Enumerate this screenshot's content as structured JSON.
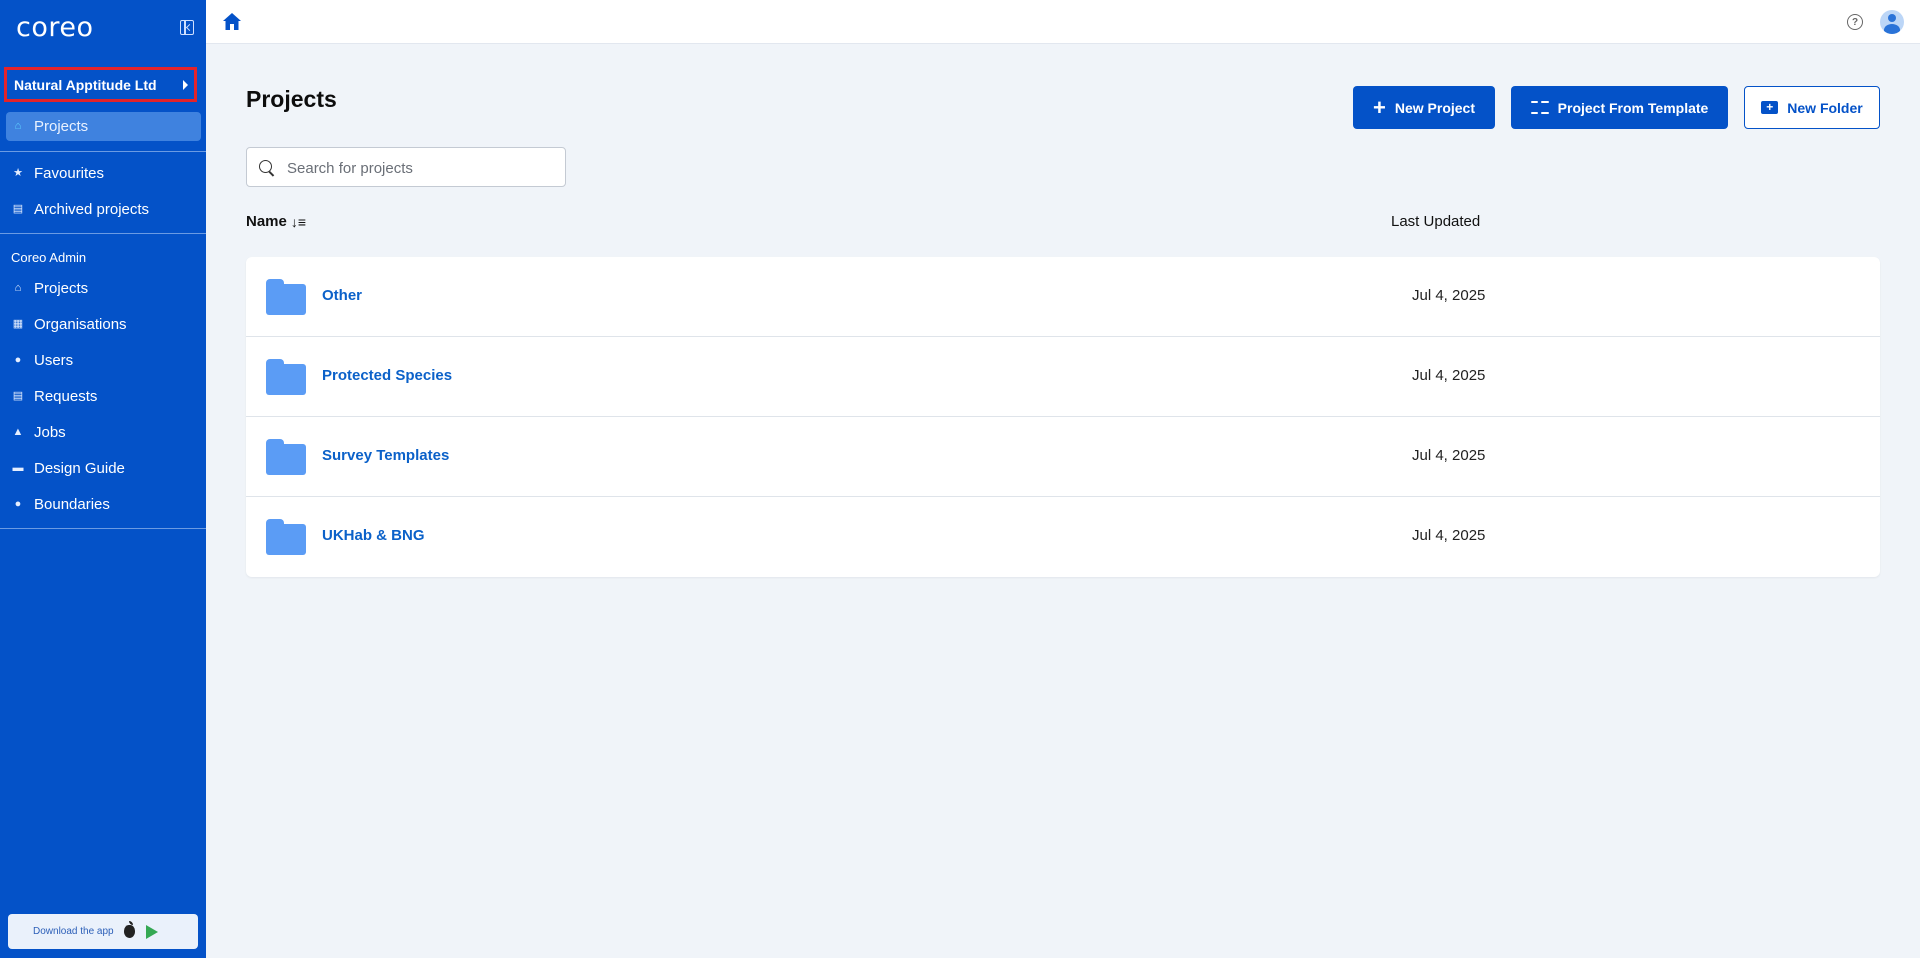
{
  "sidebar": {
    "logo": "coreo",
    "organisation": "Natural Apptitude Ltd",
    "nav_top": [
      {
        "label": "Projects",
        "icon": "home-icon",
        "active": true
      },
      {
        "label": "Favourites",
        "icon": "star-icon"
      },
      {
        "label": "Archived projects",
        "icon": "archive-icon"
      }
    ],
    "admin_section": "Coreo Admin",
    "nav_admin": [
      {
        "label": "Projects",
        "icon": "home-icon"
      },
      {
        "label": "Organisations",
        "icon": "building-icon"
      },
      {
        "label": "Users",
        "icon": "users-icon"
      },
      {
        "label": "Requests",
        "icon": "clipboard-icon"
      },
      {
        "label": "Jobs",
        "icon": "warning-icon"
      },
      {
        "label": "Design Guide",
        "icon": "paint-roller-icon"
      },
      {
        "label": "Boundaries",
        "icon": "map-pin-icon"
      }
    ],
    "download": "Download the app"
  },
  "main": {
    "title": "Projects",
    "buttons": {
      "new_project": "New Project",
      "from_template": "Project From Template",
      "new_folder": "New Folder"
    },
    "search_placeholder": "Search for projects",
    "columns": {
      "name": "Name",
      "updated": "Last Updated"
    },
    "rows": [
      {
        "name": "Other",
        "date": "Jul 4, 2025"
      },
      {
        "name": "Protected Species",
        "date": "Jul 4, 2025"
      },
      {
        "name": "Survey Templates",
        "date": "Jul 4, 2025"
      },
      {
        "name": "UKHab & BNG",
        "date": "Jul 4, 2025"
      }
    ]
  },
  "colors": {
    "brand": "#0452c8",
    "folder": "#5b9cf5",
    "highlight": "#e3232a"
  }
}
